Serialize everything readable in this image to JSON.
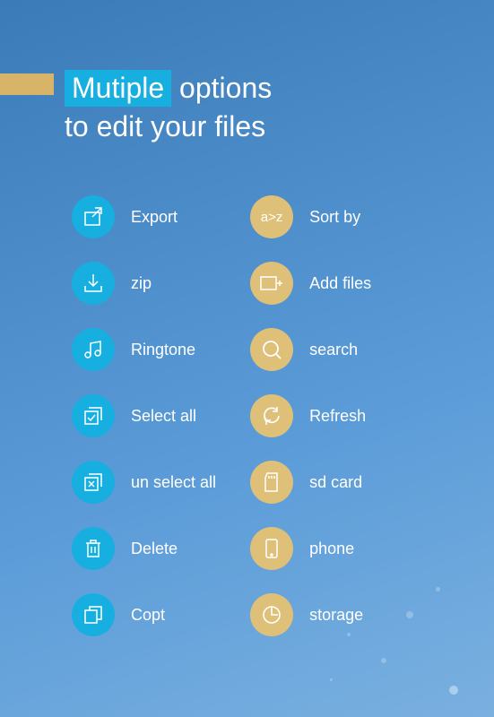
{
  "header": {
    "highlight": "Mutiple",
    "rest1": " options",
    "line2": "to edit your files"
  },
  "left_column": [
    {
      "label": "Export",
      "icon": "export-icon"
    },
    {
      "label": "zip",
      "icon": "download-icon"
    },
    {
      "label": "Ringtone",
      "icon": "music-icon"
    },
    {
      "label": "Select all",
      "icon": "select-all-icon"
    },
    {
      "label": "un select all",
      "icon": "unselect-all-icon"
    },
    {
      "label": "Delete",
      "icon": "trash-icon"
    },
    {
      "label": "Copt",
      "icon": "copy-icon"
    }
  ],
  "right_column": [
    {
      "label": "Sort by",
      "icon_text": "a>z",
      "icon": "sort-icon"
    },
    {
      "label": "Add files",
      "icon": "add-folder-icon"
    },
    {
      "label": "search",
      "icon": "search-icon"
    },
    {
      "label": "Refresh",
      "icon": "refresh-icon"
    },
    {
      "label": "sd card",
      "icon": "sd-card-icon"
    },
    {
      "label": "phone",
      "icon": "phone-icon"
    },
    {
      "label": "storage",
      "icon": "storage-icon"
    }
  ],
  "colors": {
    "blue_circle": "#17aee0",
    "gold_circle": "#dfc079",
    "accent_bar": "#d8b468"
  }
}
